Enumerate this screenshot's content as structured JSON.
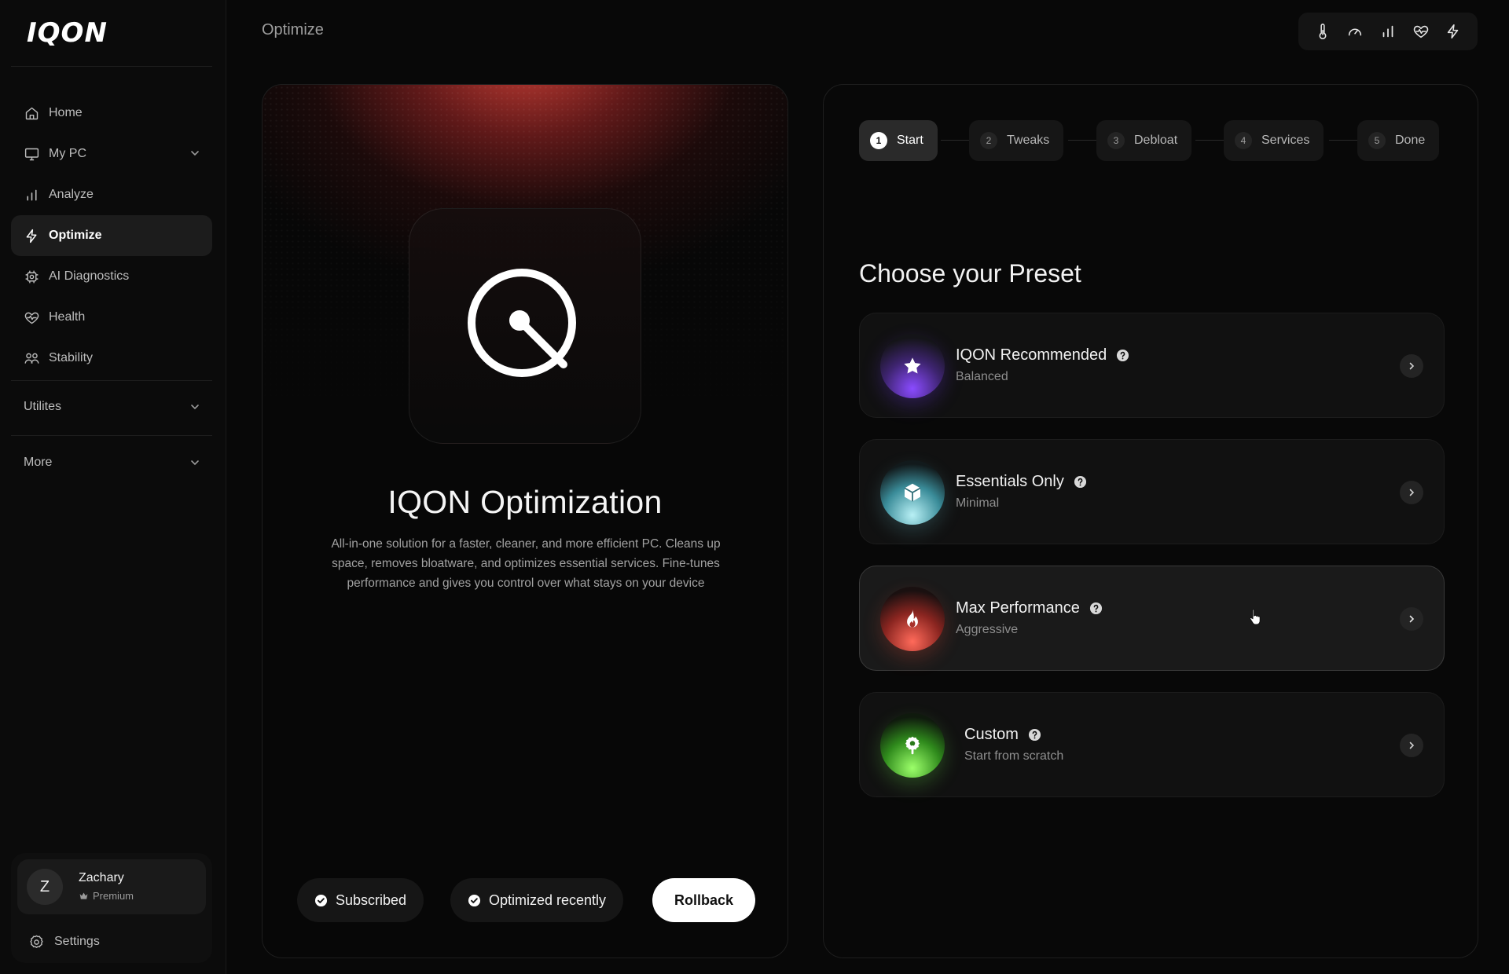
{
  "app": {
    "logo": "IQON",
    "page_title": "Optimize"
  },
  "sidebar": {
    "items": [
      {
        "label": "Home",
        "icon": "home-icon",
        "active": false,
        "has_chevron": false
      },
      {
        "label": "My PC",
        "icon": "monitor-icon",
        "active": false,
        "has_chevron": true
      },
      {
        "label": "Analyze",
        "icon": "bar-chart-icon",
        "active": false,
        "has_chevron": false
      },
      {
        "label": "Optimize",
        "icon": "lightning-icon",
        "active": true,
        "has_chevron": false
      },
      {
        "label": "AI Diagnostics",
        "icon": "chip-icon",
        "active": false,
        "has_chevron": false
      },
      {
        "label": "Health",
        "icon": "heart-pulse-icon",
        "active": false,
        "has_chevron": false
      },
      {
        "label": "Stability",
        "icon": "users-icon",
        "active": false,
        "has_chevron": false
      }
    ],
    "sections": [
      {
        "label": "Utilites"
      },
      {
        "label": "More"
      }
    ],
    "user": {
      "initial": "Z",
      "name": "Zachary",
      "plan": "Premium"
    },
    "settings_label": "Settings"
  },
  "top_icons": [
    "thermometer-icon",
    "speedometer-icon",
    "bar-chart-icon",
    "heart-pulse-icon",
    "lightning-icon"
  ],
  "hero": {
    "title": "IQON Optimization",
    "description": "All-in-one solution for a faster, cleaner, and more efficient PC. Cleans up space, removes bloatware, and optimizes essential services. Fine-tunes performance and gives you control over what stays on your device",
    "badges": [
      "Subscribed",
      "Optimized recently"
    ],
    "rollback_label": "Rollback"
  },
  "steps": [
    {
      "num": "1",
      "label": "Start",
      "active": true
    },
    {
      "num": "2",
      "label": "Tweaks",
      "active": false
    },
    {
      "num": "3",
      "label": "Debloat",
      "active": false
    },
    {
      "num": "4",
      "label": "Services",
      "active": false
    },
    {
      "num": "5",
      "label": "Done",
      "active": false
    }
  ],
  "presets": {
    "heading": "Choose your Preset",
    "items": [
      {
        "title": "IQON Recommended",
        "subtitle": "Balanced",
        "icon": "star-icon",
        "accent": "#8a4bff"
      },
      {
        "title": "Essentials Only",
        "subtitle": "Minimal",
        "icon": "cube-icon",
        "accent": "#b8f0f5"
      },
      {
        "title": "Max Performance",
        "subtitle": "Aggressive",
        "icon": "flame-icon",
        "accent": "#ff6a5a"
      },
      {
        "title": "Custom",
        "subtitle": "Start from scratch",
        "icon": "gear-wrench-icon",
        "accent": "#9cff6a"
      }
    ]
  }
}
